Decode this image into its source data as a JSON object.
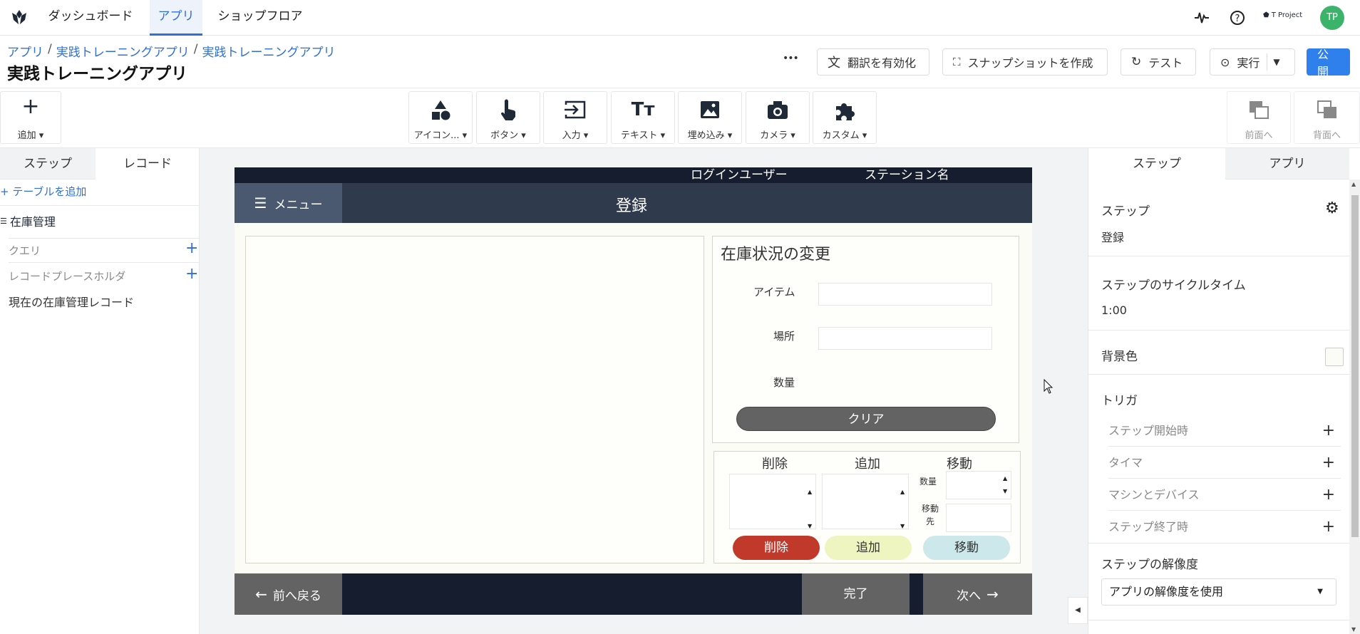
{
  "topnav": {
    "tabs": [
      "ダッシュボード",
      "アプリ",
      "ショップフロア"
    ],
    "workspace": "T Project",
    "avatar": "TP"
  },
  "header": {
    "breadcrumb": [
      "アプリ",
      "実践トレーニングアプリ",
      "実践トレーニングアプリ"
    ],
    "breadcrumb_sep": "/",
    "title": "実践トレーニングアプリ",
    "more": "•••",
    "translate_btn": "翻訳を有効化",
    "snapshot_btn": "スナップショットを作成",
    "test_btn": "テスト",
    "run_btn": "実行",
    "publish_btn": "公開"
  },
  "toolbar": {
    "add": "追加",
    "tools": [
      "アイコン...",
      "ボタン",
      "入力",
      "テキスト",
      "埋め込み",
      "カメラ",
      "カスタム"
    ],
    "front": "前面へ",
    "back": "背面へ"
  },
  "left_panel": {
    "tabs": [
      "ステップ",
      "レコード"
    ],
    "add_table": "+ テーブルを追加",
    "table_name": "在庫管理",
    "query": "クエリ",
    "placeholder": "レコードプレースホルダ",
    "current_record": "現在の在庫管理レコード"
  },
  "stage": {
    "user_label": "ログインユーザー",
    "station_label": "ステーション名",
    "menu": "メニュー",
    "step_title": "登録",
    "form_title": "在庫状況の変更",
    "item_label": "アイテム",
    "location_label": "場所",
    "quantity_label": "数量",
    "clear_btn": "クリア",
    "delete_header": "削除",
    "add_header": "追加",
    "move_header": "移動",
    "small_qty": "数量",
    "move_to_1": "移動",
    "move_to_2": "先",
    "delete_btn": "削除",
    "add_btn": "追加",
    "move_btn": "移動",
    "back_btn": "前へ戻る",
    "done_btn": "完了",
    "next_btn": "次へ",
    "colors": {
      "delete": "#c0392b",
      "add": "#eef5c0",
      "move": "#cde8ea",
      "clear": "#636363"
    }
  },
  "right_panel": {
    "tabs": [
      "ステップ",
      "アプリ"
    ],
    "step_label": "ステップ",
    "step_name": "登録",
    "cycle_label": "ステップのサイクルタイム",
    "cycle_value": "1:00",
    "bg_label": "背景色",
    "trigger_label": "トリガ",
    "triggers": [
      "ステップ開始時",
      "タイマ",
      "マシンとデバイス",
      "ステップ終了時"
    ],
    "resolution_label": "ステップの解像度",
    "resolution_value": "アプリの解像度を使用"
  }
}
